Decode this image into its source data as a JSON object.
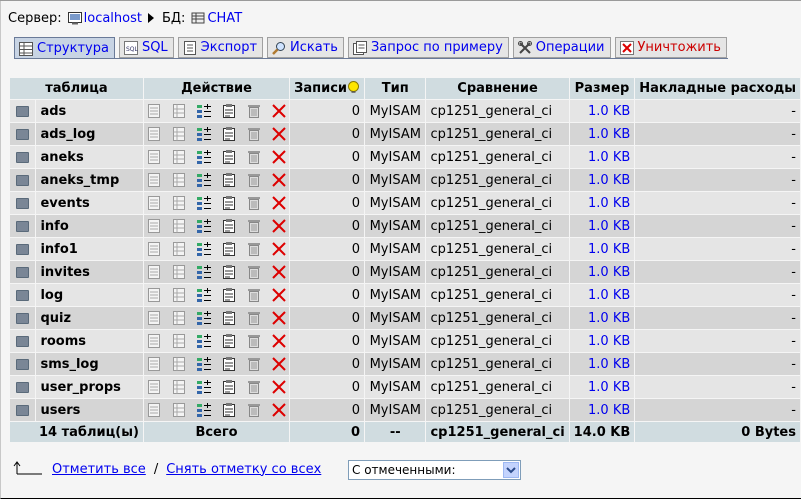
{
  "breadcrumb": {
    "server_label": "Сервер:",
    "server_name": "localhost",
    "db_label": "БД:",
    "db_name": "CHAT"
  },
  "tabs": [
    {
      "label": "Структура",
      "icon": "structure-icon",
      "active": true
    },
    {
      "label": "SQL",
      "icon": "sql-icon"
    },
    {
      "label": "Экспорт",
      "icon": "export-icon"
    },
    {
      "label": "Искать",
      "icon": "search-icon"
    },
    {
      "label": "Запрос по примеру",
      "icon": "query-icon"
    },
    {
      "label": "Операции",
      "icon": "operations-icon"
    },
    {
      "label": "Уничтожить",
      "icon": "drop-icon",
      "danger": true
    }
  ],
  "table": {
    "headers": {
      "table": "таблица",
      "action": "Действие",
      "records": "Записи",
      "type": "Тип",
      "collation": "Сравнение",
      "size": "Размер",
      "overhead": "Накладные расходы"
    },
    "rows": [
      {
        "name": "ads",
        "records": "0",
        "type": "MyISAM",
        "collation": "cp1251_general_ci",
        "size": "1.0 KB",
        "overhead": "-"
      },
      {
        "name": "ads_log",
        "records": "0",
        "type": "MyISAM",
        "collation": "cp1251_general_ci",
        "size": "1.0 KB",
        "overhead": "-"
      },
      {
        "name": "aneks",
        "records": "0",
        "type": "MyISAM",
        "collation": "cp1251_general_ci",
        "size": "1.0 KB",
        "overhead": "-"
      },
      {
        "name": "aneks_tmp",
        "records": "0",
        "type": "MyISAM",
        "collation": "cp1251_general_ci",
        "size": "1.0 KB",
        "overhead": "-"
      },
      {
        "name": "events",
        "records": "0",
        "type": "MyISAM",
        "collation": "cp1251_general_ci",
        "size": "1.0 KB",
        "overhead": "-"
      },
      {
        "name": "info",
        "records": "0",
        "type": "MyISAM",
        "collation": "cp1251_general_ci",
        "size": "1.0 KB",
        "overhead": "-"
      },
      {
        "name": "info1",
        "records": "0",
        "type": "MyISAM",
        "collation": "cp1251_general_ci",
        "size": "1.0 KB",
        "overhead": "-"
      },
      {
        "name": "invites",
        "records": "0",
        "type": "MyISAM",
        "collation": "cp1251_general_ci",
        "size": "1.0 KB",
        "overhead": "-"
      },
      {
        "name": "log",
        "records": "0",
        "type": "MyISAM",
        "collation": "cp1251_general_ci",
        "size": "1.0 KB",
        "overhead": "-"
      },
      {
        "name": "quiz",
        "records": "0",
        "type": "MyISAM",
        "collation": "cp1251_general_ci",
        "size": "1.0 KB",
        "overhead": "-"
      },
      {
        "name": "rooms",
        "records": "0",
        "type": "MyISAM",
        "collation": "cp1251_general_ci",
        "size": "1.0 KB",
        "overhead": "-"
      },
      {
        "name": "sms_log",
        "records": "0",
        "type": "MyISAM",
        "collation": "cp1251_general_ci",
        "size": "1.0 KB",
        "overhead": "-"
      },
      {
        "name": "user_props",
        "records": "0",
        "type": "MyISAM",
        "collation": "cp1251_general_ci",
        "size": "1.0 KB",
        "overhead": "-"
      },
      {
        "name": "users",
        "records": "0",
        "type": "MyISAM",
        "collation": "cp1251_general_ci",
        "size": "1.0 KB",
        "overhead": "-"
      }
    ],
    "footer": {
      "count": "14 таблиц(ы)",
      "total_label": "Всего",
      "records": "0",
      "type": "--",
      "collation": "cp1251_general_ci",
      "size": "14.0 KB",
      "overhead": "0 Bytes"
    },
    "row_actions": [
      "browse-icon",
      "structure-icon",
      "insert-icon",
      "properties-icon",
      "empty-icon",
      "drop-icon"
    ]
  },
  "bottom": {
    "check_all": "Отметить все",
    "separator": "/",
    "uncheck_all": "Снять отметку со всех",
    "with_selected": "С отмеченными:"
  },
  "colors": {
    "link": "#0000ee",
    "danger": "#cc0000",
    "header_bg": "#d0dce0",
    "row_odd": "#e5e5e5",
    "row_even": "#d5d5d5"
  }
}
